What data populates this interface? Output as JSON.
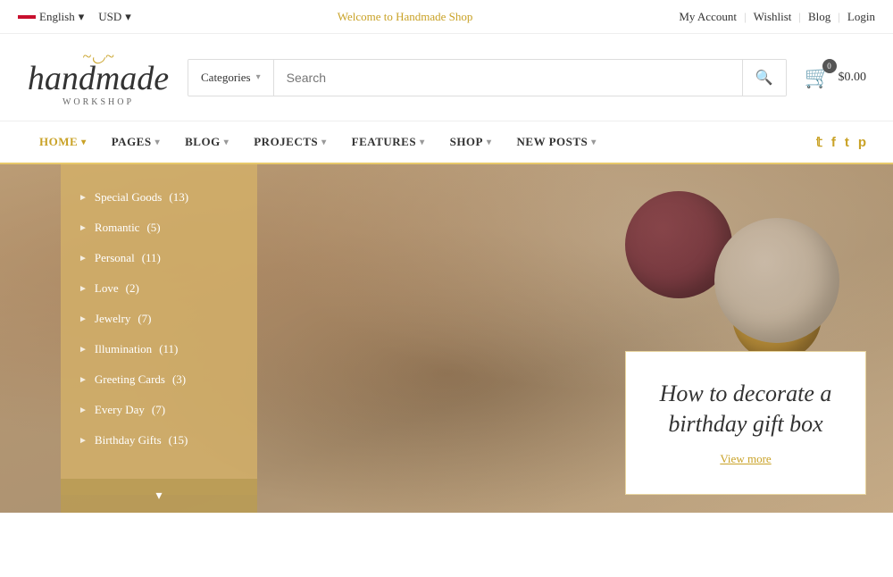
{
  "topbar": {
    "language": "English",
    "currency": "USD",
    "welcome": "Welcome to Handmade Shop",
    "links": [
      "My Account",
      "Wishlist",
      "Blog",
      "Login"
    ]
  },
  "header": {
    "logo_swirl": "〜",
    "logo_main": "handmade",
    "logo_sub": "workshop",
    "search_category": "Categories",
    "search_placeholder": "Search",
    "cart_count": "0",
    "cart_price": "$0.00"
  },
  "nav": {
    "items": [
      {
        "label": "HOME",
        "active": true,
        "has_arrow": true
      },
      {
        "label": "PAGES",
        "active": false,
        "has_arrow": true
      },
      {
        "label": "BLOG",
        "active": false,
        "has_arrow": true
      },
      {
        "label": "PROJECTS",
        "active": false,
        "has_arrow": true
      },
      {
        "label": "FEATURES",
        "active": false,
        "has_arrow": true
      },
      {
        "label": "SHOP",
        "active": false,
        "has_arrow": true
      },
      {
        "label": "NEW POSTS",
        "active": false,
        "has_arrow": true
      }
    ],
    "social": [
      "twitter",
      "facebook",
      "tumblr",
      "pinterest"
    ]
  },
  "sidebar": {
    "items": [
      {
        "label": "Special Goods",
        "count": "(13)"
      },
      {
        "label": "Romantic",
        "count": "(5)"
      },
      {
        "label": "Personal",
        "count": "(11)"
      },
      {
        "label": "Love",
        "count": "(2)"
      },
      {
        "label": "Jewelry",
        "count": "(7)"
      },
      {
        "label": "Illumination",
        "count": "(11)"
      },
      {
        "label": "Greeting Cards",
        "count": "(3)"
      },
      {
        "label": "Every Day",
        "count": "(7)"
      },
      {
        "label": "Birthday Gifts",
        "count": "(15)"
      }
    ],
    "toggle_icon": "▾"
  },
  "hero_card": {
    "title": "How to decorate a birthday gift box",
    "link_text": "View more"
  }
}
